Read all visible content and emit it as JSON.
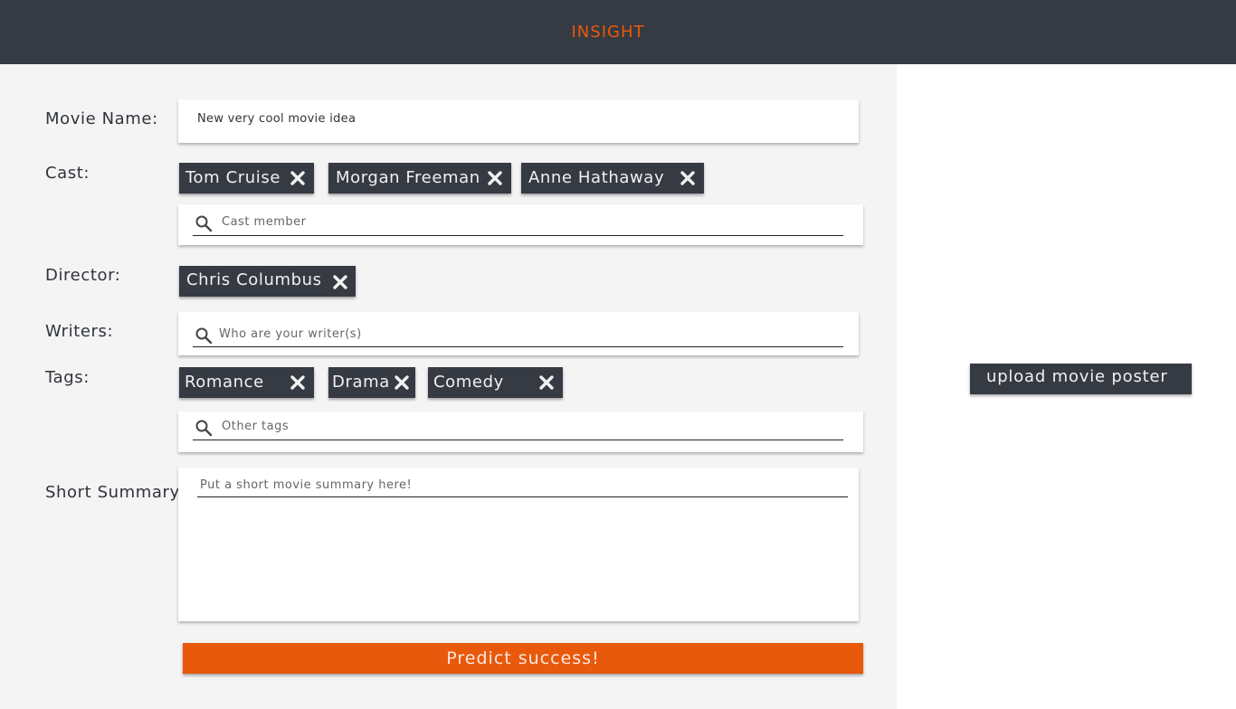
{
  "header": {
    "brand": "INSIGHT"
  },
  "form": {
    "movie_name": {
      "label": "Movie Name:",
      "value": "New very cool movie idea"
    },
    "cast": {
      "label": "Cast:",
      "chips": [
        "Tom Cruise",
        "Morgan Freeman",
        "Anne Hathaway"
      ],
      "placeholder": "Cast member"
    },
    "director": {
      "label": "Director:",
      "chips": [
        "Chris Columbus"
      ]
    },
    "writers": {
      "label": "Writers:",
      "placeholder": "Who are your writer(s)"
    },
    "tags": {
      "label": "Tags:",
      "chips": [
        "Romance",
        "Drama",
        "Comedy"
      ],
      "placeholder": "Other tags"
    },
    "summary": {
      "label": "Short Summary:",
      "placeholder": "Put a short movie summary here!"
    },
    "submit_label": "Predict success!"
  },
  "poster": {
    "upload_label": "upload movie poster"
  },
  "icons": {
    "search": "search-icon",
    "remove": "close-icon"
  },
  "colors": {
    "accent": "#e8590c",
    "dark": "#363a43",
    "panel": "#f4f4f4"
  }
}
